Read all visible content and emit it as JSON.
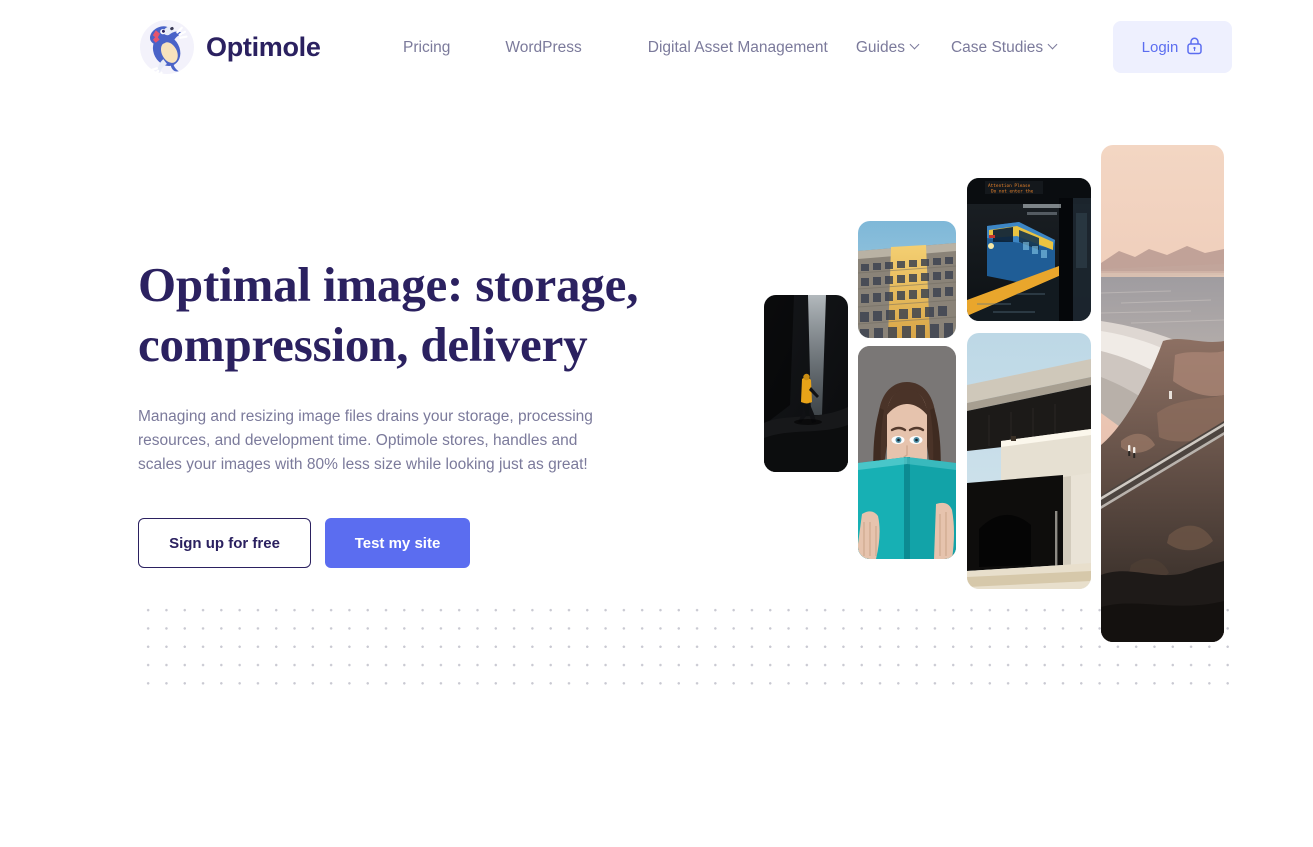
{
  "brand": {
    "name": "Optimole",
    "logo_icon": "optimole-mole-logo-icon"
  },
  "nav": {
    "items": [
      {
        "label": "Pricing",
        "has_dropdown": false
      },
      {
        "label": "WordPress",
        "has_dropdown": false
      },
      {
        "label": "Digital Asset Management",
        "has_dropdown": false
      },
      {
        "label": "Guides",
        "has_dropdown": true
      },
      {
        "label": "Case Studies",
        "has_dropdown": true
      }
    ]
  },
  "login": {
    "label": "Login",
    "icon": "lock-icon"
  },
  "hero": {
    "title_line_1": "Optimal image: storage,",
    "title_line_2": "compression, delivery",
    "subtitle": "Managing and resizing image files drains your storage, processing resources, and development time. Optimole stores, handles and scales your images with 80% less size while looking just as great!",
    "primary_cta": "Test my site",
    "secondary_cta": "Sign up for free"
  },
  "collage": {
    "photos": [
      {
        "name": "photo-cave-hiker",
        "alt": "Hiker in yellow jacket inside a dark cave beside a waterfall"
      },
      {
        "name": "photo-building",
        "alt": "Low angle of a tall building facade lit by golden sunlight"
      },
      {
        "name": "photo-train",
        "alt": "Blue and yellow train at a station platform at night"
      },
      {
        "name": "photo-reader",
        "alt": "Woman holding a teal book covering the lower half of her face"
      },
      {
        "name": "photo-overpass",
        "alt": "Concrete overpass architecture against a pale blue sky"
      },
      {
        "name": "photo-coastline",
        "alt": "Aerial coastline at sunset with beach, cliffs and a road"
      }
    ]
  },
  "colors": {
    "brand_navy": "#2b2160",
    "accent_blue": "#5b6df0",
    "login_bg": "#eef0fe",
    "body_text": "#7b7a9b",
    "dot_grid": "#c9c9d2",
    "page_bg": "#ffffff"
  }
}
